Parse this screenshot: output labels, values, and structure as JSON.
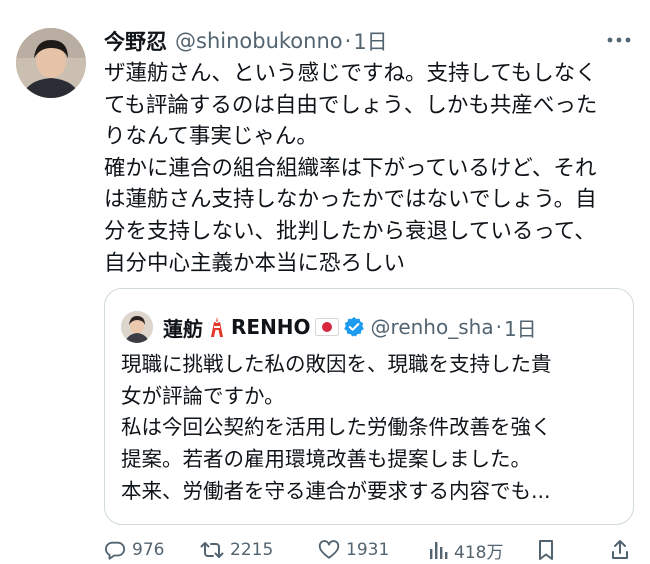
{
  "tweet": {
    "author_name": "今野忍",
    "handle": "@shinobukonno",
    "separator": "·",
    "time": "1日",
    "lines": [
      "ザ蓮舫さん、という感じですね。支持してもしなく",
      "ても評論するのは自由でしょう、しかも共産べった",
      "りなんて事実じゃん。",
      "確かに連合の組合組織率は下がっているけど、それ",
      "は蓮舫さん支持しなかったかではないでしょう。自",
      "分を支持しない、批判したから衰退しているって、",
      "自分中心主義か本当に恐ろしい"
    ]
  },
  "quote": {
    "author_name": "蓮舫",
    "author_name_latin": "RENHO",
    "handle": "@renho_sha",
    "separator": "·",
    "time": "1日",
    "lines": [
      "現職に挑戦した私の敗因を、現職を支持した貴",
      "女が評論ですか。",
      "私は今回公契約を活用した労働条件改善を強く",
      "提案。若者の雇用環境改善も提案しました。",
      "本来、労働者を守る連合が要求する内容でも..."
    ]
  },
  "actions": {
    "replies": "976",
    "reposts": "2215",
    "likes": "1931",
    "views": "418万"
  },
  "colors": {
    "text": "#0f1419",
    "muted": "#536471",
    "verified": "#1d9bf0",
    "border": "#cfd9de"
  },
  "icons": [
    "more-icon",
    "tokyo-tower-icon",
    "japan-flag-icon",
    "verified-badge-icon",
    "reply-icon",
    "repost-icon",
    "like-icon",
    "views-icon",
    "bookmark-icon",
    "share-icon"
  ]
}
